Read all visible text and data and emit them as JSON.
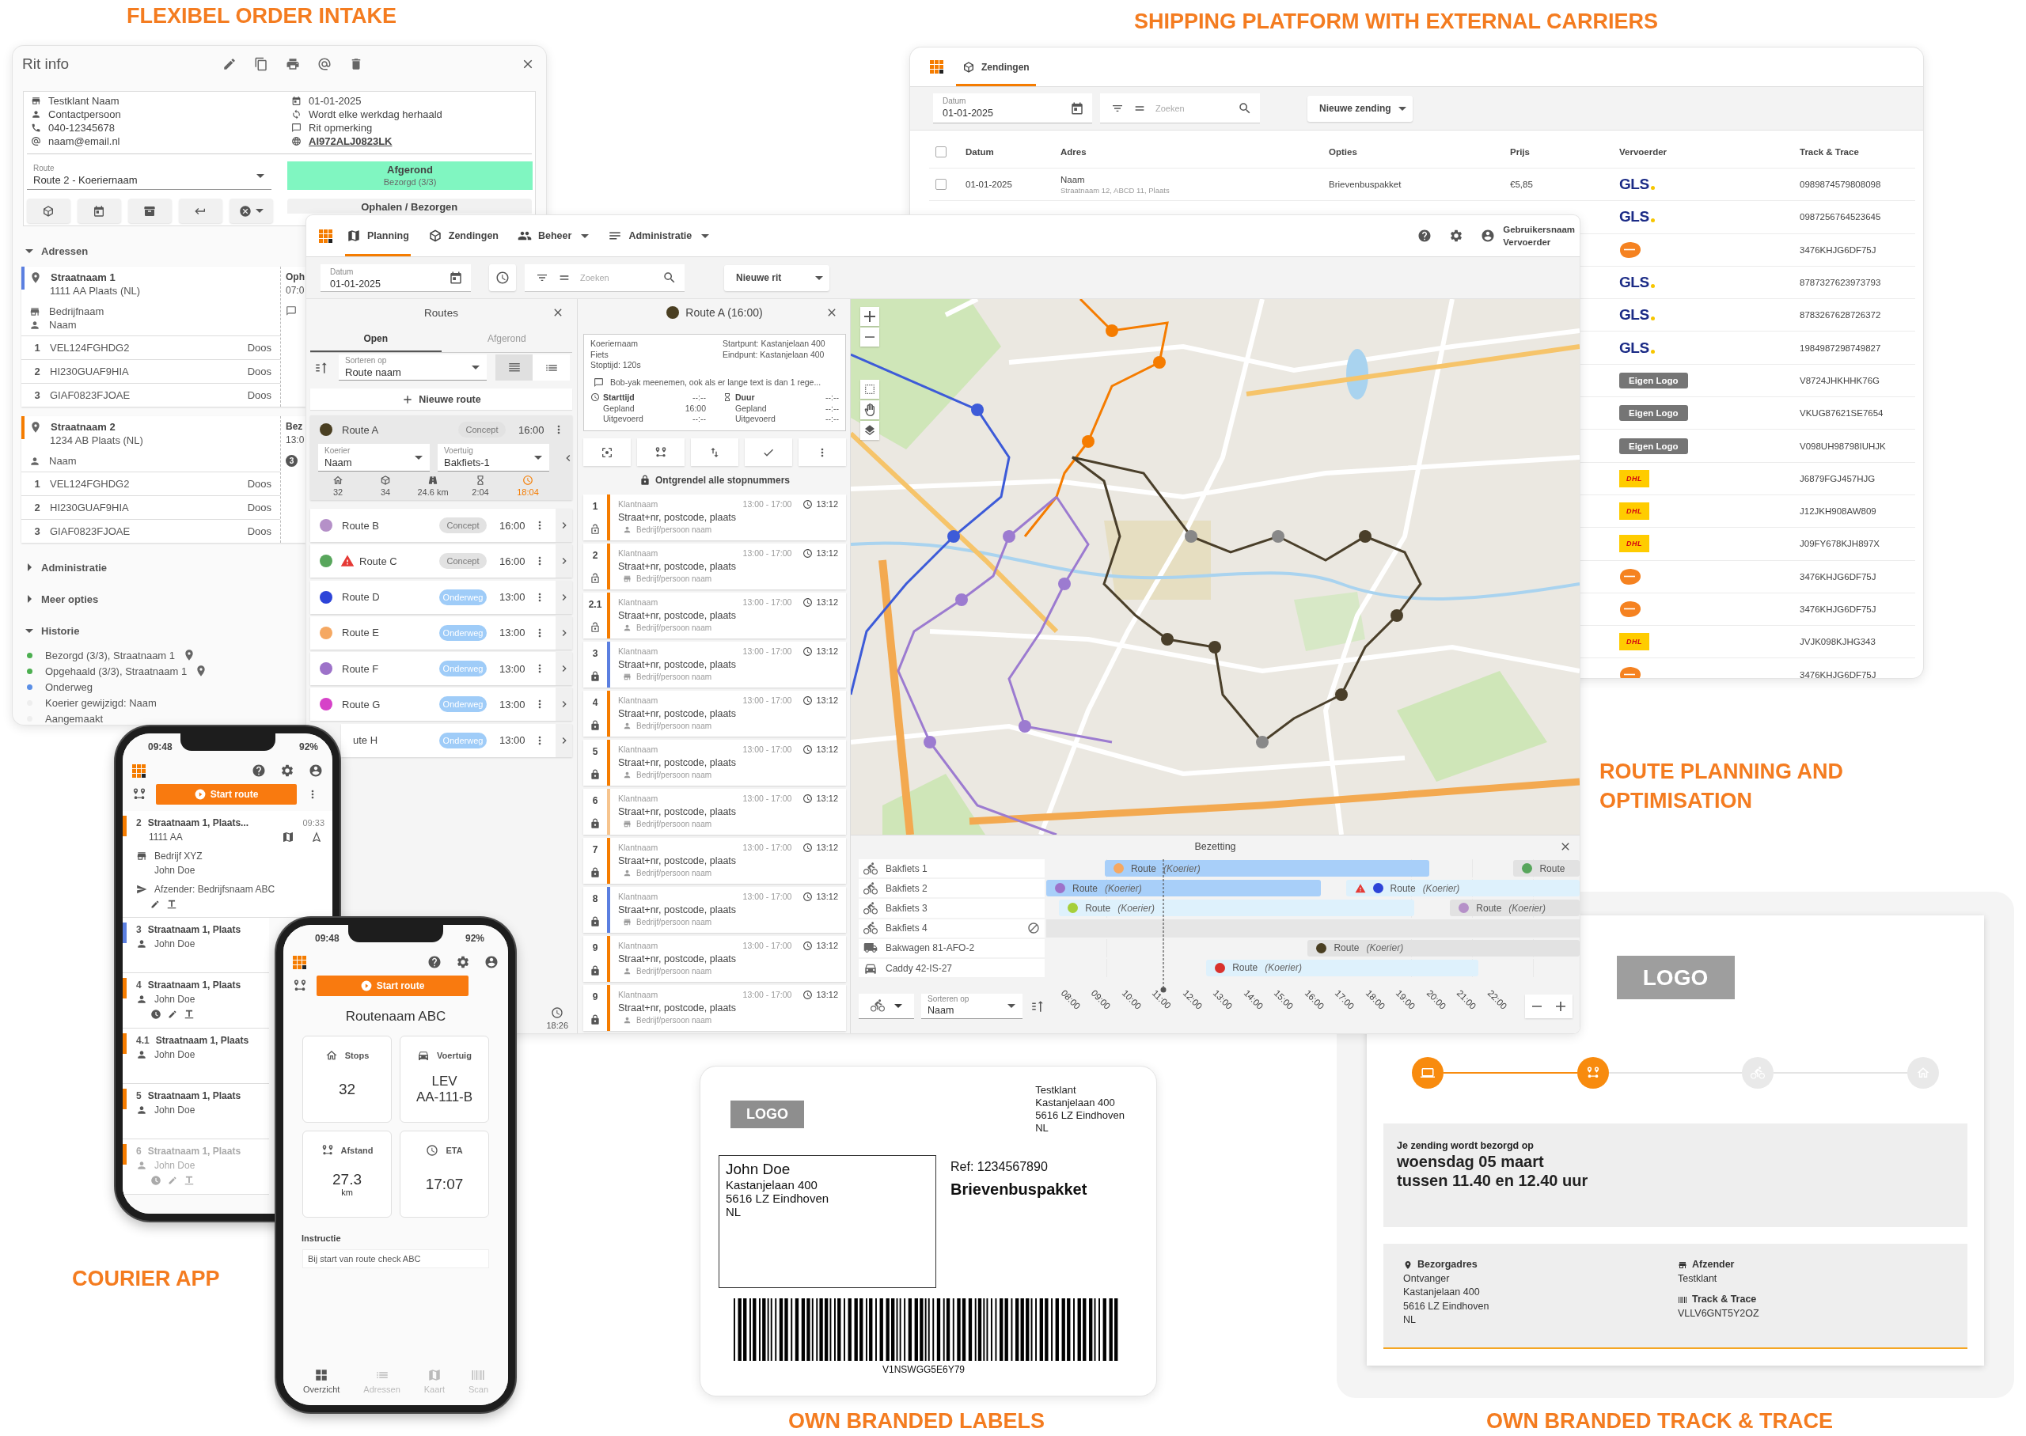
{
  "order_intake": {
    "heading": "FLEXIBEL ORDER INTAKE",
    "title": "Rit info",
    "contact": [
      {
        "kind": "company",
        "text": "Testklant Naam"
      },
      {
        "kind": "person",
        "text": "Contactpersoon"
      },
      {
        "kind": "phone",
        "text": "040-12345678"
      },
      {
        "kind": "email",
        "text": "naam@email.nl"
      }
    ],
    "schedule": [
      {
        "kind": "date",
        "text": "01-01-2025"
      },
      {
        "kind": "repeat",
        "text": "Wordt elke werkdag herhaald"
      },
      {
        "kind": "note",
        "text": "Rit opmerking"
      },
      {
        "kind": "link",
        "text": "AI972ALJ0823LK"
      }
    ],
    "route_select": {
      "label": "Route",
      "value": "Route 2 - Koeriernaam"
    },
    "status": {
      "kind": "done",
      "title": "Afgerond",
      "detail": "Bezorgd (3/3)"
    },
    "pickup_button": "Ophalen / Bezorgen",
    "addresses": {
      "label": "Adressen",
      "expanded": true,
      "items": [
        {
          "street": "Straatnaam 1",
          "city": "1111 AA Plaats (NL)",
          "color": "#5b7fe0",
          "company": "Bedrijfnaam",
          "contact": "Naam",
          "side": {
            "title": "Oph",
            "time": "07:0",
            "note": true
          },
          "parcels": [
            {
              "no": "1",
              "code": "VEL124FGHDG2",
              "type": "Doos"
            },
            {
              "no": "2",
              "code": "HI230GUAF9HIA",
              "type": "Doos"
            },
            {
              "no": "3",
              "code": "GIAF0823FJOAE",
              "type": "Doos"
            }
          ]
        },
        {
          "street": "Straatnaam 2",
          "city": "1234 AB Plaats (NL)",
          "color": "#f57c00",
          "contact": "Naam",
          "side": {
            "title": "Bez",
            "time": "13:0",
            "note": false,
            "count": "3"
          },
          "parcels": [
            {
              "no": "1",
              "code": "VEL124FGHDG2",
              "type": "Doos"
            },
            {
              "no": "2",
              "code": "HI230GUAF9HIA",
              "type": "Doos"
            },
            {
              "no": "3",
              "code": "GIAF0823FJOAE",
              "type": "Doos"
            }
          ]
        }
      ]
    },
    "sections": [
      {
        "label": "Administratie",
        "expanded": false
      },
      {
        "label": "Meer opties",
        "expanded": false
      }
    ],
    "history": {
      "label": "Historie",
      "expanded": true,
      "events": [
        {
          "text": "Bezorgd (3/3), Straatnaam 1",
          "color": "#4caf50",
          "located": true
        },
        {
          "text": "Opgehaald (3/3), Straatnaam 1",
          "color": "#4caf50",
          "located": true
        },
        {
          "text": "Onderweg",
          "color": "#5b8fe6",
          "located": false
        },
        {
          "text": "Koerier gewijzigd: Naam",
          "color": "#eeeeee",
          "located": false
        },
        {
          "text": "Aangemaakt",
          "color": "#eeeeee",
          "located": false
        }
      ]
    }
  },
  "shipping": {
    "heading": "SHIPPING PLATFORM WITH EXTERNAL CARRIERS",
    "nav": [
      {
        "kind": "parcel",
        "label": "Zendingen",
        "selected": true
      }
    ],
    "date_field": {
      "label": "Datum",
      "value": "01-01-2025"
    },
    "search": {
      "placeholder": "Zoeken"
    },
    "new_button": "Nieuwe zending",
    "table": {
      "columns": [
        "Datum",
        "Adres",
        "Opties",
        "Prijs",
        "Vervoerder",
        "Track & Trace"
      ],
      "select_all": {
        "checked": false
      },
      "rows": [
        {
          "checked": false,
          "date": "01-01-2025",
          "name": "Naam",
          "address": "Straatnaam 12, ABCD 11, Plaats",
          "option": "Brievenbuspakket",
          "price": "€5,85",
          "carrier": {
            "kind": "gls",
            "label": "GLS"
          },
          "tracking": "0989874579808098"
        },
        {
          "carrier": {
            "kind": "gls",
            "label": "GLS"
          },
          "tracking": "0987256764523645"
        },
        {
          "carrier": {
            "kind": "postnl"
          },
          "tracking": "3476KHJG6DF75J"
        },
        {
          "carrier": {
            "kind": "gls",
            "label": "GLS"
          },
          "tracking": "8787327623973793"
        },
        {
          "carrier": {
            "kind": "gls",
            "label": "GLS"
          },
          "tracking": "8783267628726372"
        },
        {
          "carrier": {
            "kind": "gls",
            "label": "GLS"
          },
          "tracking": "1984987298749827"
        },
        {
          "carrier": {
            "kind": "own",
            "label": "Eigen Logo"
          },
          "tracking": "V8724JHKHHK76G"
        },
        {
          "carrier": {
            "kind": "own",
            "label": "Eigen Logo"
          },
          "tracking": "VKUG87621SE7654"
        },
        {
          "carrier": {
            "kind": "own",
            "label": "Eigen Logo"
          },
          "tracking": "V098UH98798IUHJK"
        },
        {
          "carrier": {
            "kind": "dhl",
            "label": "DHL"
          },
          "tracking": "J6879FGJ457HJG"
        },
        {
          "carrier": {
            "kind": "dhl",
            "label": "DHL"
          },
          "tracking": "J12JKH908AW809"
        },
        {
          "carrier": {
            "kind": "dhl",
            "label": "DHL"
          },
          "tracking": "J09FY678KJH897X"
        },
        {
          "carrier": {
            "kind": "postnl"
          },
          "tracking": "3476KHJG6DF75J"
        },
        {
          "carrier": {
            "kind": "postnl"
          },
          "tracking": "3476KHJG6DF75J"
        },
        {
          "carrier": {
            "kind": "dhl",
            "label": "DHL"
          },
          "tracking": "JVJK098KJHG343"
        },
        {
          "carrier": {
            "kind": "postnl"
          },
          "tracking": "3476KHJG6DF75J"
        }
      ]
    }
  },
  "planning": {
    "heading": "ROUTE PLANNING AND OPTIMISATION",
    "nav": [
      {
        "kind": "map",
        "label": "Planning",
        "selected": true,
        "menu": false
      },
      {
        "kind": "parcel",
        "label": "Zendingen",
        "selected": false,
        "menu": false
      },
      {
        "kind": "people",
        "label": "Beheer",
        "selected": false,
        "menu": true
      },
      {
        "kind": "list",
        "label": "Administratie",
        "selected": false,
        "menu": true
      }
    ],
    "user": {
      "name": "Gebruikersnaam",
      "role": "Vervoerder"
    },
    "date_field": {
      "label": "Datum",
      "value": "01-01-2025"
    },
    "search": {
      "placeholder": "Zoeken"
    },
    "new_button": "Nieuwe rit",
    "routes": {
      "title": "Routes",
      "tabs": [
        {
          "label": "Open",
          "selected": true
        },
        {
          "label": "Afgerond",
          "selected": false
        }
      ],
      "sort": {
        "label": "Sorteren op",
        "value": "Route naam"
      },
      "views": [
        {
          "kind": "compact",
          "selected": true
        },
        {
          "kind": "list",
          "selected": false
        }
      ],
      "add_button": "Nieuwe route",
      "items": [
        {
          "name": "Route A",
          "color": "#4a3f22",
          "status": "Concept",
          "kind": "concept",
          "time": "16:00",
          "warning": false,
          "expanded": true,
          "courier": {
            "label": "Koerier",
            "value": "Naam"
          },
          "vehicle": {
            "label": "Voertuig",
            "value": "Bakfiets-1"
          },
          "stats": [
            {
              "kind": "stops",
              "value": "32",
              "alert": false
            },
            {
              "kind": "parcels",
              "value": "34",
              "alert": false
            },
            {
              "kind": "distance",
              "value": "24.6 km",
              "alert": false
            },
            {
              "kind": "duration",
              "value": "2:04",
              "alert": false
            },
            {
              "kind": "eta",
              "value": "18:04",
              "alert": true
            }
          ]
        },
        {
          "name": "Route B",
          "color": "#b590c8",
          "status": "Concept",
          "kind": "concept",
          "time": "16:00",
          "warning": false,
          "expanded": false
        },
        {
          "name": "Route C",
          "color": "#58a65c",
          "status": "Concept",
          "kind": "concept",
          "time": "16:00",
          "warning": true,
          "expanded": false
        },
        {
          "name": "Route D",
          "color": "#2d44d8",
          "status": "Onderweg",
          "kind": "transit",
          "time": "13:00",
          "warning": false,
          "expanded": false
        },
        {
          "name": "Route E",
          "color": "#f5a862",
          "status": "Onderweg",
          "kind": "transit",
          "time": "13:00",
          "warning": false,
          "expanded": false
        },
        {
          "name": "Route F",
          "color": "#9d72c9",
          "status": "Onderweg",
          "kind": "transit",
          "time": "13:00",
          "warning": false,
          "expanded": false
        },
        {
          "name": "Route G",
          "color": "#d642c8",
          "status": "Onderweg",
          "kind": "transit",
          "time": "13:00",
          "warning": false,
          "expanded": false
        },
        {
          "name": "ute H",
          "status": "Onderweg",
          "kind": "transit",
          "time": "13:00",
          "warning": false,
          "expanded": false
        }
      ],
      "footer_time": "18:26"
    },
    "detail": {
      "title": "Route A (16:00)",
      "color": "#4a3f22",
      "left": [
        "Koeriernaam",
        "Fiets",
        "Stoptijd: 120s"
      ],
      "right": [
        "Startpunt: Kastanjelaan 400",
        "Eindpunt: Kastanjelaan 400"
      ],
      "note": "Bob-yak meenemen, ook als er lange text is dan 1 rege...",
      "times": [
        {
          "kind": "start",
          "label": "Starttijd",
          "value": "--:--",
          "rows": [
            {
              "label": "Gepland",
              "value": "16:00"
            },
            {
              "label": "Uitgevoerd",
              "value": "--:--"
            }
          ]
        },
        {
          "kind": "duration",
          "label": "Duur",
          "value": "--:--",
          "rows": [
            {
              "label": "Gepland",
              "value": "--:--"
            },
            {
              "label": "Uitgevoerd",
              "value": "--:--"
            }
          ]
        }
      ],
      "unlock": "Ontgrendel alle stopnummers",
      "stops": [
        {
          "no": "1",
          "customer": "Klantnaam",
          "window": "13:00 - 17:00",
          "eta": "13:12",
          "address": "Straat+nr, postcode, plaats",
          "contact": "Bedrijf/persoon naam",
          "kind": "person",
          "locked": false,
          "color": "#f57c00"
        },
        {
          "no": "2",
          "customer": "Klantnaam",
          "window": "13:00 - 17:00",
          "eta": "13:12",
          "address": "Straat+nr, postcode, plaats",
          "contact": "Bedrijf/persoon naam",
          "kind": "company",
          "locked": false,
          "color": "#f57c00"
        },
        {
          "no": "2.1",
          "customer": "Klantnaam",
          "window": "13:00 - 17:00",
          "eta": "13:12",
          "address": "Straat+nr, postcode, plaats",
          "contact": "Bedrijf/persoon naam",
          "kind": "person",
          "locked": false,
          "color": "#f57c00"
        },
        {
          "no": "3",
          "customer": "Klantnaam",
          "window": "13:00 - 17:00",
          "eta": "13:12",
          "address": "Straat+nr, postcode, plaats",
          "contact": "Bedrijf/persoon naam",
          "kind": "company",
          "locked": true,
          "color": "#5b7fe0"
        },
        {
          "no": "4",
          "customer": "Klantnaam",
          "window": "13:00 - 17:00",
          "eta": "13:12",
          "address": "Straat+nr, postcode, plaats",
          "contact": "Bedrijf/persoon naam",
          "kind": "person",
          "locked": true,
          "color": "#f57c00"
        },
        {
          "no": "5",
          "customer": "Klantnaam",
          "window": "13:00 - 17:00",
          "eta": "13:12",
          "address": "Straat+nr, postcode, plaats",
          "contact": "Bedrijf/persoon naam",
          "kind": "person",
          "locked": true,
          "color": "#f57c00"
        },
        {
          "no": "6",
          "customer": "Klantnaam",
          "window": "13:00 - 17:00",
          "eta": "13:12",
          "address": "Straat+nr, postcode, plaats",
          "contact": "Bedrijf/persoon naam",
          "kind": "company",
          "locked": true,
          "color": "#f6c48e"
        },
        {
          "no": "7",
          "customer": "Klantnaam",
          "window": "13:00 - 17:00",
          "eta": "13:12",
          "address": "Straat+nr, postcode, plaats",
          "contact": "Bedrijf/persoon naam",
          "kind": "person",
          "locked": true,
          "color": "#f57c00"
        },
        {
          "no": "8",
          "customer": "Klantnaam",
          "window": "13:00 - 17:00",
          "eta": "13:12",
          "address": "Straat+nr, postcode, plaats",
          "contact": "Bedrijf/persoon naam",
          "kind": "company",
          "locked": true,
          "color": "#5b7fe0"
        },
        {
          "no": "9",
          "customer": "Klantnaam",
          "window": "13:00 - 17:00",
          "eta": "13:12",
          "address": "Straat+nr, postcode, plaats",
          "contact": "Bedrijf/persoon naam",
          "kind": "person",
          "locked": true,
          "color": "#f57c00"
        },
        {
          "no": "9",
          "customer": "Klantnaam",
          "window": "13:00 - 17:00",
          "eta": "13:12",
          "address": "Straat+nr, postcode, plaats",
          "contact": "Bedrijf/persoon naam",
          "kind": "person",
          "locked": true,
          "color": "#f57c00"
        }
      ]
    },
    "occupancy": {
      "title": "Bezetting",
      "vehicles": [
        {
          "kind": "bike",
          "name": "Bakfiets 1",
          "blocked": false,
          "bookings": [
            {
              "label": "Route",
              "courier": "(Koerier)",
              "color": "#f5a862",
              "kind": "active",
              "warning": false
            },
            {
              "label": "Route",
              "color": "#58a65c",
              "kind": "concept",
              "warning": false
            }
          ]
        },
        {
          "kind": "bike",
          "name": "Bakfiets 2",
          "blocked": false,
          "bookings": [
            {
              "label": "Route",
              "courier": "(Koerier)",
              "color": "#9d72c9",
              "kind": "active",
              "warning": false
            },
            {
              "label": "Route",
              "courier": "(Koerier)",
              "color": "#2d44d8",
              "kind": "planned",
              "warning": true
            }
          ]
        },
        {
          "kind": "bike",
          "name": "Bakfiets 3",
          "blocked": false,
          "bookings": [
            {
              "label": "Route",
              "courier": "(Koerier)",
              "color": "#a6cf3a",
              "kind": "planned",
              "warning": false
            },
            {
              "label": "Route",
              "courier": "(Koerier)",
              "color": "#b590c8",
              "kind": "concept",
              "warning": false
            }
          ]
        },
        {
          "kind": "bike",
          "name": "Bakfiets 4",
          "blocked": true
        },
        {
          "kind": "van",
          "name": "Bakwagen 81-AFO-2",
          "blocked": false,
          "bookings": [
            {
              "label": "Route",
              "courier": "(Koerier)",
              "color": "#4a3f22",
              "kind": "concept",
              "warning": false
            }
          ]
        },
        {
          "kind": "car",
          "name": "Caddy 42-IS-27",
          "blocked": false,
          "bookings": [
            {
              "label": "Route",
              "courier": "(Koerier)",
              "color": "#d9322e",
              "kind": "planned",
              "warning": false
            }
          ]
        }
      ],
      "sort": {
        "label": "Sorteren op",
        "value": "Naam"
      },
      "hours": [
        "08:00",
        "09:00",
        "10:00",
        "11:00",
        "12:00",
        "13:00",
        "14:00",
        "15:00",
        "16:00",
        "17:00",
        "18:00",
        "19:00",
        "20:00",
        "21:00",
        "22:00"
      ]
    }
  },
  "courier_app": {
    "heading": "COURIER APP",
    "list_phone": {
      "clock": "09:48",
      "battery": "92%",
      "start_button": "Start route",
      "stops": [
        {
          "no": "2",
          "street": "Straatnaam 1, Plaats...",
          "postcode": "1111 AA",
          "time": "09:33",
          "company": "Bedrijf XYZ",
          "contact": "John Doe",
          "sender": "Afzender: Bedrijfsnaam ABC",
          "color": "#f57c00",
          "expanded": true,
          "done": false,
          "tools": true,
          "marked": false
        },
        {
          "no": "3",
          "street": "Straatnaam 1, Plaats",
          "contact": "John Doe",
          "color": "#5b7fe0",
          "done": false,
          "tools": false
        },
        {
          "no": "4",
          "street": "Straatnaam 1, Plaats",
          "contact": "John Doe",
          "color": "#f57c00",
          "done": false,
          "tools": true,
          "marked": true
        },
        {
          "no": "4.1",
          "street": "Straatnaam 1, Plaats",
          "contact": "John Doe",
          "color": "#f57c00",
          "done": false,
          "tools": false
        },
        {
          "no": "5",
          "street": "Straatnaam 1, Plaats",
          "contact": "John Doe",
          "color": "#f57c00",
          "done": false,
          "tools": false
        },
        {
          "no": "6",
          "street": "Straatnaam 1, Plaats",
          "contact": "John Doe",
          "color": "#f57c00",
          "done": true,
          "tools": true,
          "marked": true
        }
      ]
    },
    "overview_phone": {
      "clock": "09:48",
      "battery": "92%",
      "start_button": "Start route",
      "route_name": "Routenaam ABC",
      "cards": [
        {
          "kind": "stops",
          "label": "Stops",
          "lines": [
            "32"
          ]
        },
        {
          "kind": "vehicle",
          "label": "Voertuig",
          "lines": [
            "LEV",
            "AA-111-B"
          ]
        },
        {
          "kind": "distance",
          "label": "Afstand",
          "lines": [
            "27.3"
          ],
          "unit": "km"
        },
        {
          "kind": "eta",
          "label": "ETA",
          "lines": [
            "17:07"
          ]
        }
      ],
      "instruction": {
        "label": "Instructie",
        "value": "Bij start van route check ABC"
      },
      "nav": [
        {
          "kind": "overview",
          "label": "Overzicht",
          "selected": true
        },
        {
          "kind": "addresses",
          "label": "Adressen",
          "selected": false
        },
        {
          "kind": "map",
          "label": "Kaart",
          "selected": false
        },
        {
          "kind": "scan",
          "label": "Scan",
          "selected": false
        }
      ]
    }
  },
  "shipping_label": {
    "heading": "OWN BRANDED LABELS",
    "logo": "LOGO",
    "sender": [
      "Testklant",
      "Kastanjelaan 400",
      "5616 LZ Eindhoven",
      "NL"
    ],
    "recipient": [
      "John Doe",
      "Kastanjelaan 400",
      "5616 LZ Eindhoven",
      "NL"
    ],
    "reference": "Ref: 1234567890",
    "product": "Brievenbuspakket",
    "barcode": "V1NSWGG5E6Y79"
  },
  "track_trace": {
    "heading": "OWN BRANDED TRACK & TRACE",
    "logo": "LOGO",
    "steps": [
      {
        "kind": "ordered",
        "done": true
      },
      {
        "kind": "planned",
        "done": true
      },
      {
        "kind": "transit",
        "done": false
      },
      {
        "kind": "delivered",
        "done": false
      }
    ],
    "message": {
      "intro": "Je zending wordt bezorgd op",
      "day": "woensdag 05 maart",
      "window": "tussen 11.40 en 12.40 uur"
    },
    "delivery_address": {
      "label": "Bezorgadres",
      "lines": [
        "Ontvanger",
        "Kastanjelaan 400",
        "5616 LZ Eindhoven",
        "NL"
      ]
    },
    "sender": {
      "label": "Afzender",
      "value": "Testklant"
    },
    "tracking": {
      "label": "Track & Trace",
      "value": "VLLV6GNT5Y2OZ"
    }
  }
}
